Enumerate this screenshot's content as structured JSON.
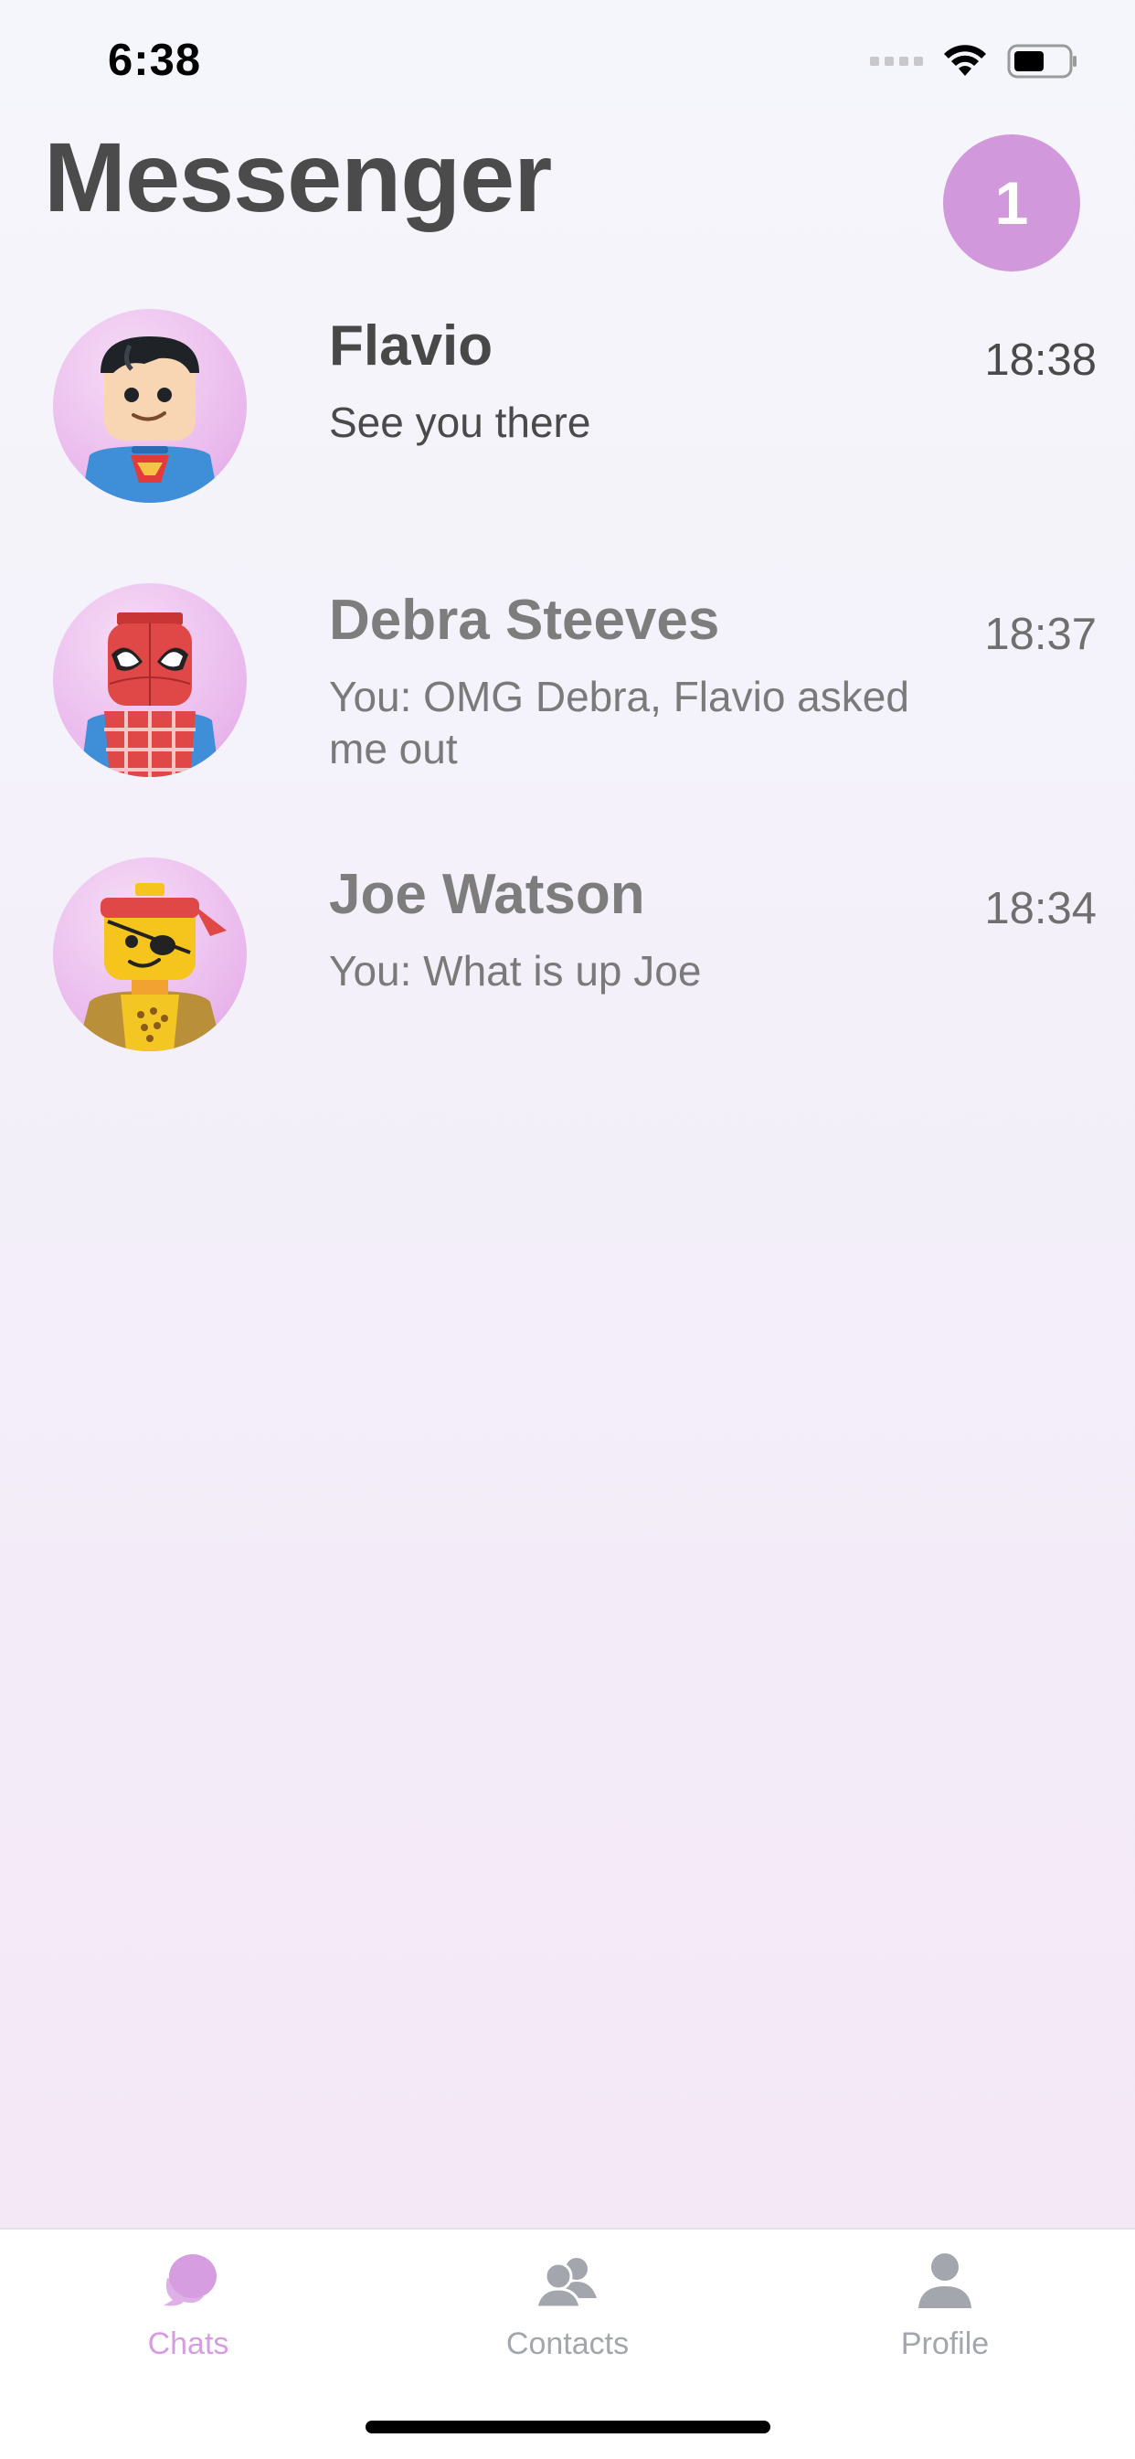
{
  "status_bar": {
    "time": "6:38",
    "icons": [
      "signal-icon",
      "wifi-icon",
      "battery-icon"
    ]
  },
  "header": {
    "title": "Messenger",
    "unread_count": "1",
    "accent_color": "#d198dc"
  },
  "chats": [
    {
      "name": "Flavio",
      "preview": "See you there",
      "time": "18:38",
      "unread": true,
      "avatar_icon": "superhero-avatar-icon"
    },
    {
      "name": "Debra Steeves",
      "preview": "You: OMG Debra, Flavio asked me out",
      "time": "18:37",
      "unread": false,
      "avatar_icon": "spider-hero-avatar-icon"
    },
    {
      "name": "Joe Watson",
      "preview": "You: What is up Joe",
      "time": "18:34",
      "unread": false,
      "avatar_icon": "pirate-avatar-icon"
    }
  ],
  "tabs": [
    {
      "label": "Chats",
      "icon": "chat-bubbles-icon",
      "active": true
    },
    {
      "label": "Contacts",
      "icon": "contacts-icon",
      "active": false
    },
    {
      "label": "Profile",
      "icon": "person-icon",
      "active": false
    }
  ]
}
